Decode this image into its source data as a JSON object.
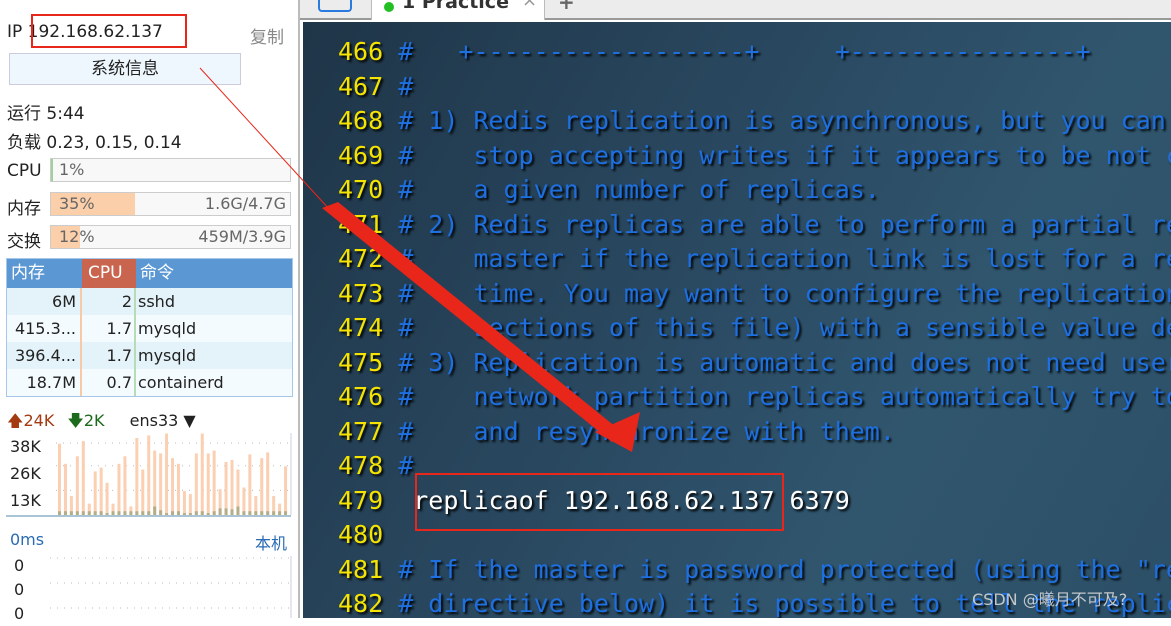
{
  "sidebar": {
    "ip_label": "IP",
    "ip": "192.168.62.137",
    "copy": "复制",
    "sysinfo_button": "系统信息",
    "uptime_label": "运行",
    "uptime": "5:44",
    "load_label": "负载",
    "load": "0.23, 0.15, 0.14",
    "cpu": {
      "label": "CPU",
      "pct": "1%",
      "value": 1
    },
    "mem": {
      "label": "内存",
      "pct": "35%",
      "value": 35,
      "amount": "1.6G/4.7G"
    },
    "swap": {
      "label": "交换",
      "pct": "12%",
      "value": 12,
      "amount": "459M/3.9G"
    },
    "proc_headers": [
      "内存",
      "CPU",
      "命令"
    ],
    "processes": [
      [
        "6M",
        "2",
        "sshd"
      ],
      [
        "415.3...",
        "1.7",
        "mysqld"
      ],
      [
        "396.4...",
        "1.7",
        "mysqld"
      ],
      [
        "18.7M",
        "0.7",
        "containerd"
      ]
    ],
    "net": {
      "up": "24K",
      "down": "2K",
      "iface": "ens33",
      "ticks": [
        "38K",
        "26K",
        "13K"
      ],
      "up_values_k": [
        37.6,
        27,
        10,
        31,
        39,
        6,
        23,
        25,
        17,
        6,
        27,
        31,
        4.5,
        40.7,
        24,
        42,
        34,
        32.5,
        43,
        30,
        27,
        12.6,
        11,
        32.5,
        43,
        32.5,
        34,
        13.6,
        28,
        29,
        24,
        14.5,
        32,
        10,
        30,
        33,
        10,
        6,
        25.7
      ],
      "down_values_k": [
        2,
        2,
        2,
        2,
        2,
        2,
        2,
        2,
        1,
        2,
        2,
        2,
        2,
        2,
        2,
        2,
        4.5,
        2.5,
        1,
        2,
        2,
        1,
        1,
        2,
        2,
        1,
        2,
        3.5,
        3.5,
        3,
        4.5,
        2,
        2,
        2,
        2,
        2,
        2,
        2,
        2
      ]
    },
    "latency": {
      "label": "0ms",
      "host": "本机",
      "values": [
        "0",
        "0",
        "0"
      ]
    },
    "colors": {
      "mem_fill": "#fbcfaa",
      "cpu_fill": "#9fd29b",
      "proc_header": "#5b97d2",
      "cpu_header": "#c9654f",
      "up_arrow": "#a33a10",
      "down_arrow": "#1c6a1c"
    }
  },
  "tabs": {
    "active": "1 Practice",
    "close": "×",
    "add": "+"
  },
  "editor": {
    "lines": [
      {
        "n": "466",
        "t": " #   +------------------+     +---------------+",
        "k": "cm"
      },
      {
        "n": "467",
        "t": " #",
        "k": "cm"
      },
      {
        "n": "468",
        "t": " # 1) Redis replication is asynchronous, but you can",
        "k": "cm"
      },
      {
        "n": "469",
        "t": " #    stop accepting writes if it appears to be not c",
        "k": "cm"
      },
      {
        "n": "470",
        "t": " #    a given number of replicas.",
        "k": "cm"
      },
      {
        "n": "471",
        "t": " # 2) Redis replicas are able to perform a partial re",
        "k": "cm"
      },
      {
        "n": "472",
        "t": " #    master if the replication link is lost for a re",
        "k": "cm"
      },
      {
        "n": "473",
        "t": " #    time. You may want to configure the replication",
        "k": "cm"
      },
      {
        "n": "474",
        "t": " #    sections of this file) with a sensible value de",
        "k": "cm"
      },
      {
        "n": "475",
        "t": " # 3) Replication is automatic and does not need user",
        "k": "cm"
      },
      {
        "n": "476",
        "t": " #    network partition replicas automatically try to",
        "k": "cm"
      },
      {
        "n": "477",
        "t": " #    and resynchronize with them.",
        "k": "cm"
      },
      {
        "n": "478",
        "t": " #",
        "k": "cm"
      },
      {
        "n": "479",
        "t": "  replicaof 192.168.62.137 6379",
        "k": "cf"
      },
      {
        "n": "480",
        "t": "",
        "k": "cm"
      },
      {
        "n": "481",
        "t": " # If the master is password protected (using the \"re",
        "k": "cm"
      },
      {
        "n": "482",
        "t": " # directive below) it is possible to tell the replic",
        "k": "cm"
      }
    ]
  },
  "watermark": "CSDN @曦月不可及?"
}
